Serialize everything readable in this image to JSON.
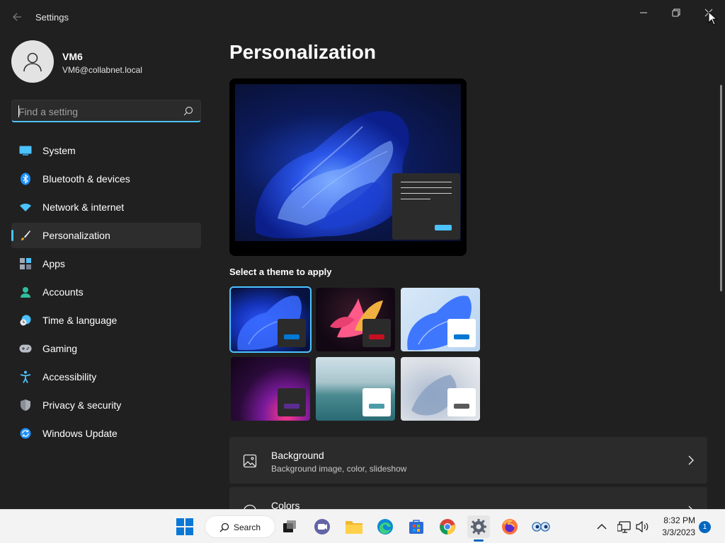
{
  "window": {
    "app_title": "Settings",
    "back_icon": "back-arrow-icon",
    "controls": [
      "minimize-icon",
      "restore-icon",
      "close-icon"
    ]
  },
  "profile": {
    "name": "VM6",
    "email": "VM6@collabnet.local"
  },
  "search": {
    "placeholder": "Find a setting",
    "value": ""
  },
  "sidebar": {
    "items": [
      {
        "label": "System",
        "icon": "system-icon"
      },
      {
        "label": "Bluetooth & devices",
        "icon": "bluetooth-icon"
      },
      {
        "label": "Network & internet",
        "icon": "wifi-icon"
      },
      {
        "label": "Personalization",
        "icon": "paintbrush-icon",
        "active": true
      },
      {
        "label": "Apps",
        "icon": "apps-icon"
      },
      {
        "label": "Accounts",
        "icon": "accounts-icon"
      },
      {
        "label": "Time & language",
        "icon": "clock-globe-icon"
      },
      {
        "label": "Gaming",
        "icon": "gamepad-icon"
      },
      {
        "label": "Accessibility",
        "icon": "accessibility-icon"
      },
      {
        "label": "Privacy & security",
        "icon": "shield-icon"
      },
      {
        "label": "Windows Update",
        "icon": "update-icon"
      }
    ]
  },
  "main": {
    "title": "Personalization",
    "themes_label": "Select a theme to apply",
    "themes": [
      {
        "name": "windows-dark",
        "accent": "#0078d4",
        "selected": true
      },
      {
        "name": "glow",
        "accent": "#c50f1f"
      },
      {
        "name": "windows-light",
        "accent": "#0078d4"
      },
      {
        "name": "captured-motion",
        "accent": "#5c2d91"
      },
      {
        "name": "sunrise",
        "accent": "#4a9ca8"
      },
      {
        "name": "flow",
        "accent": "#5a5a5a"
      }
    ],
    "cards": [
      {
        "title": "Background",
        "subtitle": "Background image, color, slideshow",
        "icon": "image-icon"
      },
      {
        "title": "Colors",
        "subtitle": "",
        "icon": "palette-icon"
      }
    ]
  },
  "taskbar": {
    "search_label": "Search",
    "apps": [
      "start-icon",
      "search-icon",
      "task-view-icon",
      "teams-chat-icon",
      "file-explorer-icon",
      "edge-icon",
      "store-icon",
      "chrome-icon",
      "settings-icon",
      "firefox-icon",
      "remote-viewer-icon"
    ],
    "time": "8:32 PM",
    "date": "3/3/2023",
    "notification_count": "1"
  },
  "colors": {
    "accent": "#4cc2ff",
    "background": "#202020",
    "card": "#2b2b2b",
    "taskbar": "#f3f3f3"
  }
}
